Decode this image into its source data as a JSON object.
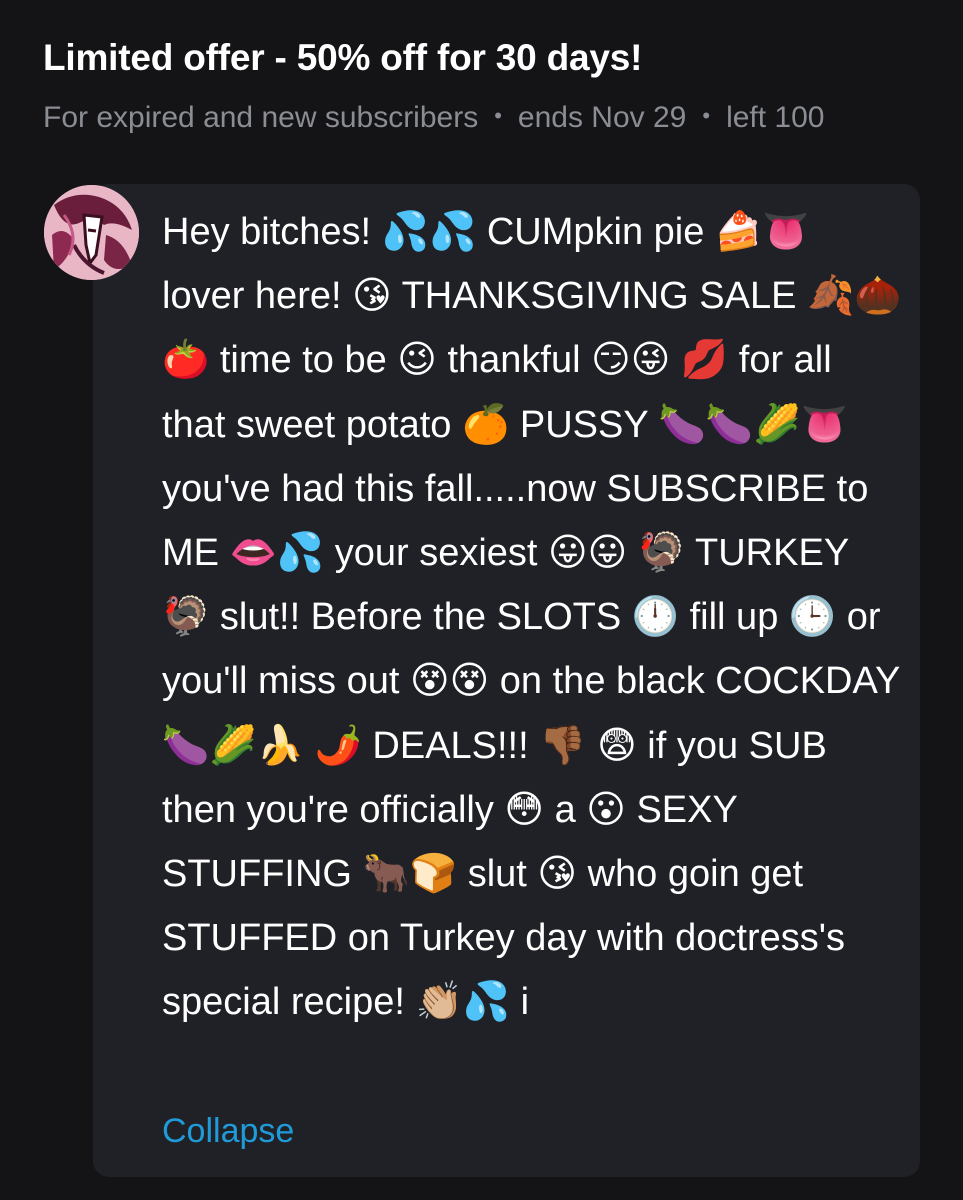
{
  "offer": {
    "title": "Limited offer - 50% off for 30 days!",
    "audience": "For expired and new subscribers",
    "ends": "ends Nov 29",
    "left": "left 100"
  },
  "post": {
    "avatar_icon": "creator-avatar",
    "message_segments": [
      "Hey bitches! 💦💦 CUMpkin pie 🍰👅",
      " lover here! 😘 THANKSGIVING SALE",
      " 🍂🌰🍅 time to be 😉 thankful 😏😜",
      " 💋 for all that sweet potato 🍊 PUSSY",
      " 🍆🍆🌽👅 you've had this fall.....now",
      " SUBSCRIBE to ME 👄💦 your sexiest",
      " 😛😛 🦃 TURKEY 🦃 slut!! Before the",
      " SLOTS 🕛 fill up 🕒 or you'll miss out",
      " 😵😵 on the black COCKDAY 🍆🌽🍌",
      " 🌶️ DEALS!!! 👎🏾 😨 if you SUB then",
      " you're officially 😳 a 😮 SEXY",
      " STUFFING 🐂🍞 slut 😘 who goin get",
      " STUFFED on Turkey day with",
      " doctress's special recipe! 👏🏼💦 i"
    ],
    "collapse_label": "Collapse"
  },
  "colors": {
    "background": "#141416",
    "bubble": "#202126",
    "meta_text": "#8a8d93",
    "link": "#1f9bd9"
  }
}
